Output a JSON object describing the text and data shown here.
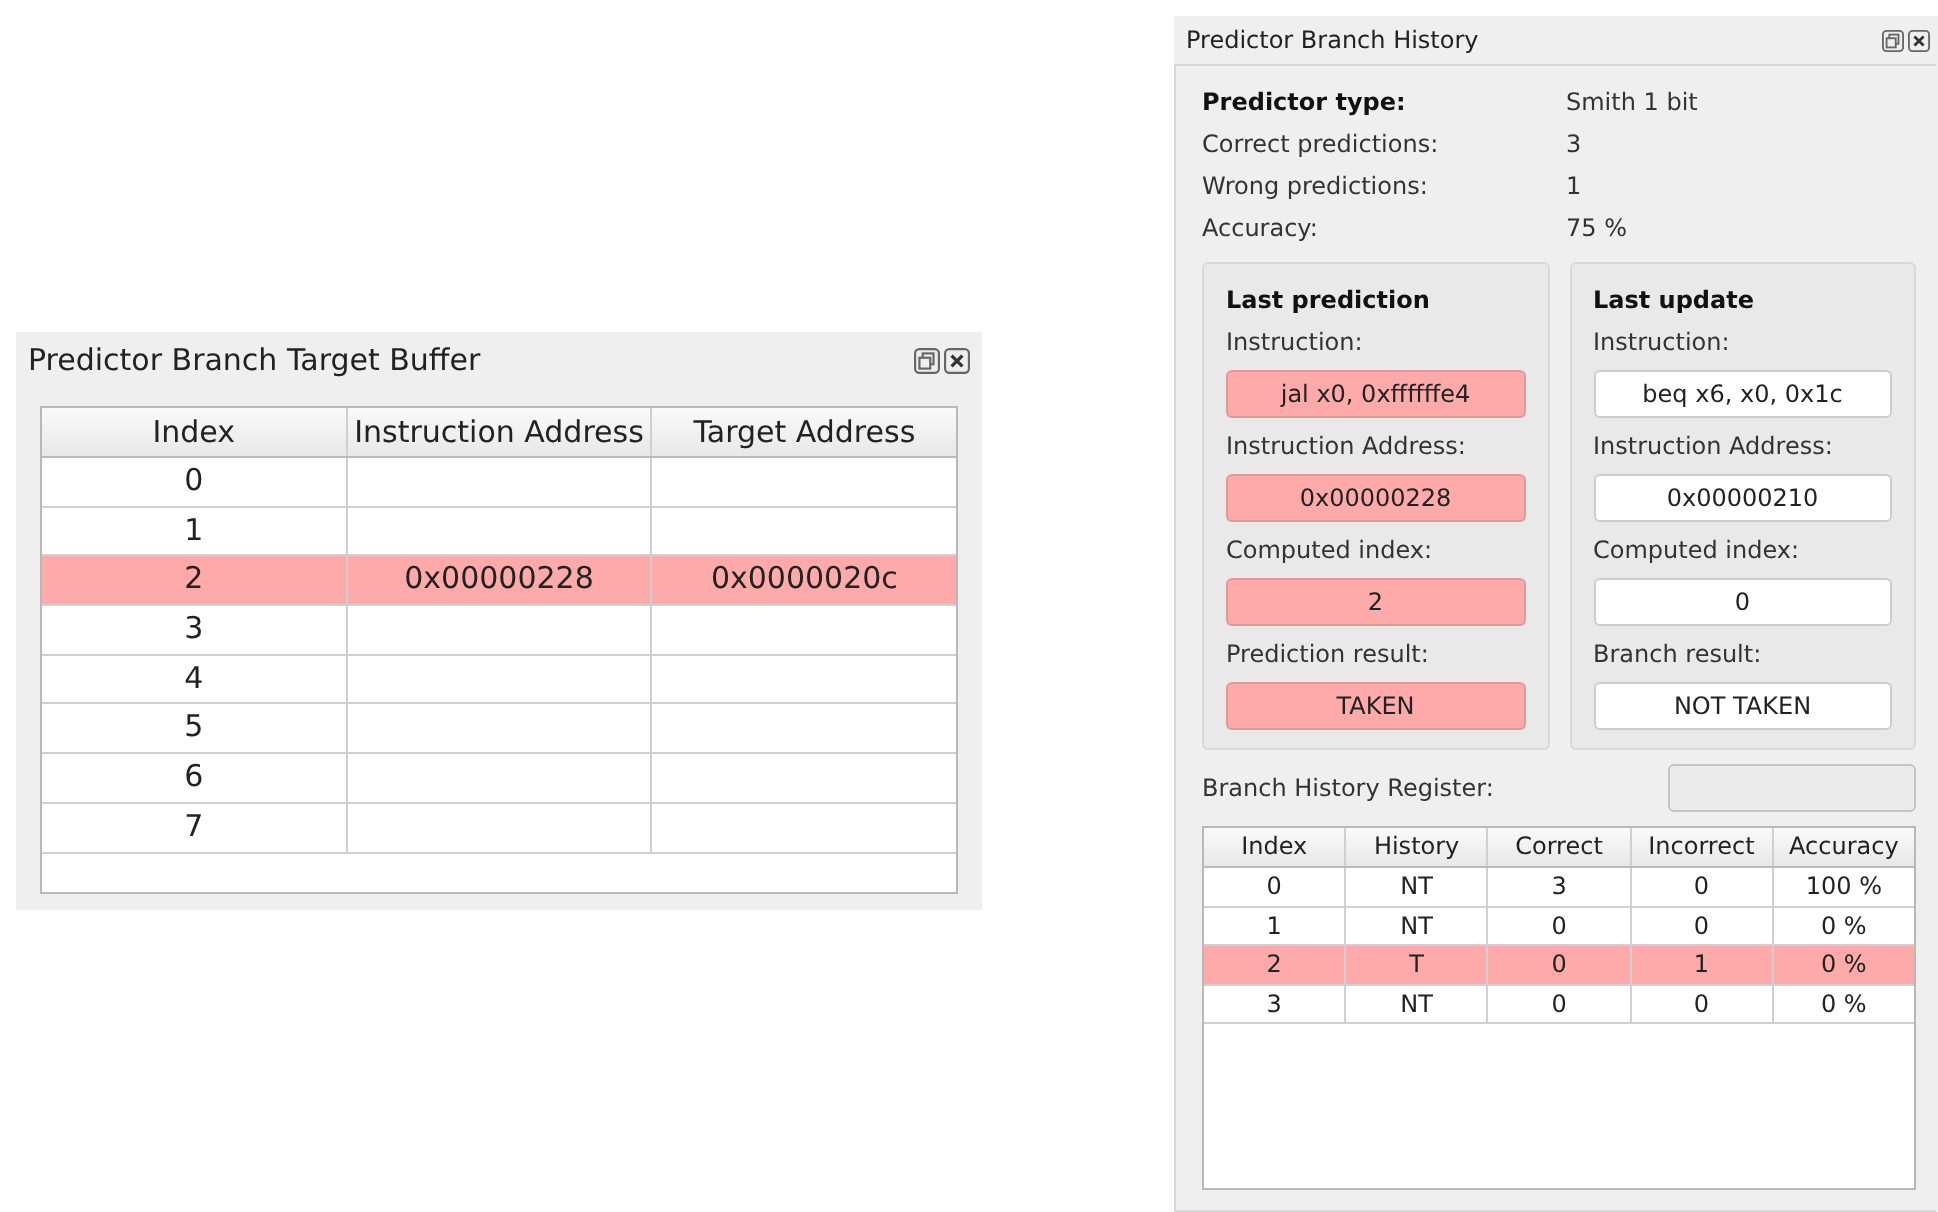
{
  "btb_window": {
    "title": "Predictor Branch Target Buffer",
    "table": {
      "columns": [
        "Index",
        "Instruction Address",
        "Target Address"
      ],
      "rows": [
        {
          "cells": [
            "0",
            "",
            ""
          ],
          "highlighted": false
        },
        {
          "cells": [
            "1",
            "",
            ""
          ],
          "highlighted": false
        },
        {
          "cells": [
            "2",
            "0x00000228",
            "0x0000020c"
          ],
          "highlighted": true
        },
        {
          "cells": [
            "3",
            "",
            ""
          ],
          "highlighted": false
        },
        {
          "cells": [
            "4",
            "",
            ""
          ],
          "highlighted": false
        },
        {
          "cells": [
            "5",
            "",
            ""
          ],
          "highlighted": false
        },
        {
          "cells": [
            "6",
            "",
            ""
          ],
          "highlighted": false
        },
        {
          "cells": [
            "7",
            "",
            ""
          ],
          "highlighted": false
        }
      ]
    }
  },
  "history_window": {
    "title": "Predictor Branch History",
    "summary": [
      {
        "label": "Predictor type:",
        "value": "Smith 1 bit",
        "bold": true
      },
      {
        "label": "Correct predictions:",
        "value": "3",
        "bold": false
      },
      {
        "label": "Wrong predictions:",
        "value": "1",
        "bold": false
      },
      {
        "label": "Accuracy:",
        "value": "75 %",
        "bold": false
      }
    ],
    "groups": [
      {
        "title": "Last prediction",
        "fields": [
          {
            "label": "Instruction:",
            "value": "jal x0, 0xffffffe4",
            "highlighted": true
          },
          {
            "label": "Instruction Address:",
            "value": "0x00000228",
            "highlighted": true
          },
          {
            "label": "Computed index:",
            "value": "2",
            "highlighted": true
          },
          {
            "label": "Prediction result:",
            "value": "TAKEN",
            "highlighted": true
          }
        ]
      },
      {
        "title": "Last update",
        "fields": [
          {
            "label": "Instruction:",
            "value": "beq x6, x0, 0x1c",
            "highlighted": false
          },
          {
            "label": "Instruction Address:",
            "value": "0x00000210",
            "highlighted": false
          },
          {
            "label": "Computed index:",
            "value": "0",
            "highlighted": false
          },
          {
            "label": "Branch result:",
            "value": "NOT TAKEN",
            "highlighted": false
          }
        ]
      }
    ],
    "bhr": {
      "label": "Branch History Register:",
      "disabled": true
    },
    "table": {
      "columns": [
        "Index",
        "History",
        "Correct",
        "Incorrect",
        "Accuracy"
      ],
      "rows": [
        {
          "cells": [
            "0",
            "NT",
            "3",
            "0",
            "100 %"
          ],
          "highlighted": false
        },
        {
          "cells": [
            "1",
            "NT",
            "0",
            "0",
            "0 %"
          ],
          "highlighted": false
        },
        {
          "cells": [
            "2",
            "T",
            "0",
            "1",
            "0 %"
          ],
          "highlighted": true
        },
        {
          "cells": [
            "3",
            "NT",
            "0",
            "0",
            "0 %"
          ],
          "highlighted": false
        }
      ]
    }
  }
}
